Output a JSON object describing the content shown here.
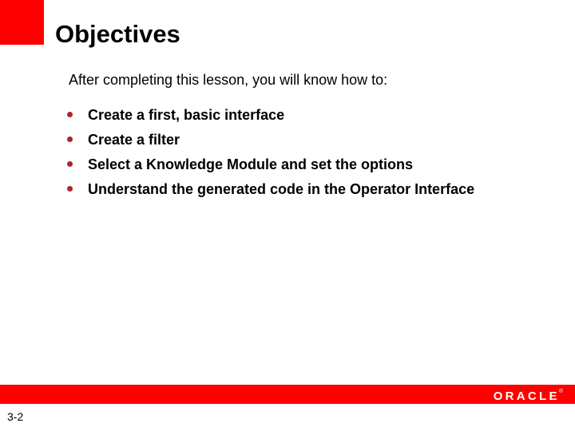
{
  "slide": {
    "title": "Objectives",
    "lead_in": "After completing this lesson, you will know how to:",
    "bullets": [
      {
        "text": "Create a first, basic interface"
      },
      {
        "text": "Create a filter"
      },
      {
        "text": "Select a Knowledge Module and set the options"
      },
      {
        "text": "Understand the generated code in the Operator Interface"
      }
    ],
    "page_number": "3-2"
  },
  "footer": {
    "brand": "ORACLE",
    "trademark": "®"
  },
  "colors": {
    "accent_red": "#fe0000",
    "bullet_marker": "#b22234",
    "text": "#000000",
    "background": "#ffffff"
  }
}
